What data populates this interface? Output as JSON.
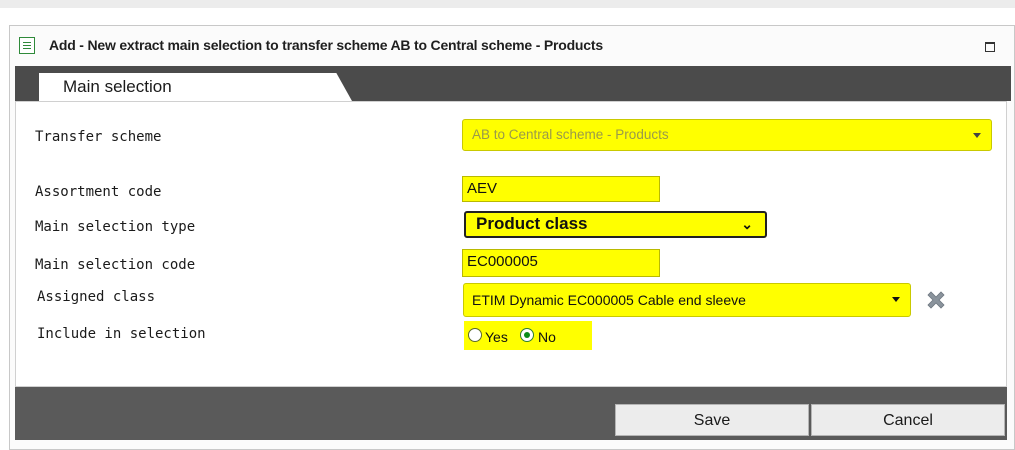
{
  "window": {
    "title": "Add - New extract main selection to transfer scheme AB to Central scheme - Products",
    "icon": "form-icon"
  },
  "tabs": [
    {
      "label": "Main selection",
      "active": true
    }
  ],
  "form": {
    "transfer_scheme": {
      "label": "Transfer scheme",
      "value": "AB to Central scheme - Products"
    },
    "assortment_code": {
      "label": "Assortment code",
      "value": "AEV"
    },
    "main_selection_type": {
      "label": "Main selection type",
      "value": "Product class"
    },
    "main_selection_code": {
      "label": "Main selection code",
      "value": "EC000005"
    },
    "assigned_class": {
      "label": "Assigned class",
      "value": "ETIM Dynamic EC000005 Cable end sleeve"
    },
    "include_in_selection": {
      "label": "Include in selection",
      "options": [
        "Yes",
        "No"
      ],
      "selected": "No"
    }
  },
  "buttons": {
    "save": "Save",
    "cancel": "Cancel"
  },
  "colors": {
    "field_highlight": "#ffff00",
    "bar": "#4b4b4b",
    "radio_checked": "#0a8c1a"
  }
}
